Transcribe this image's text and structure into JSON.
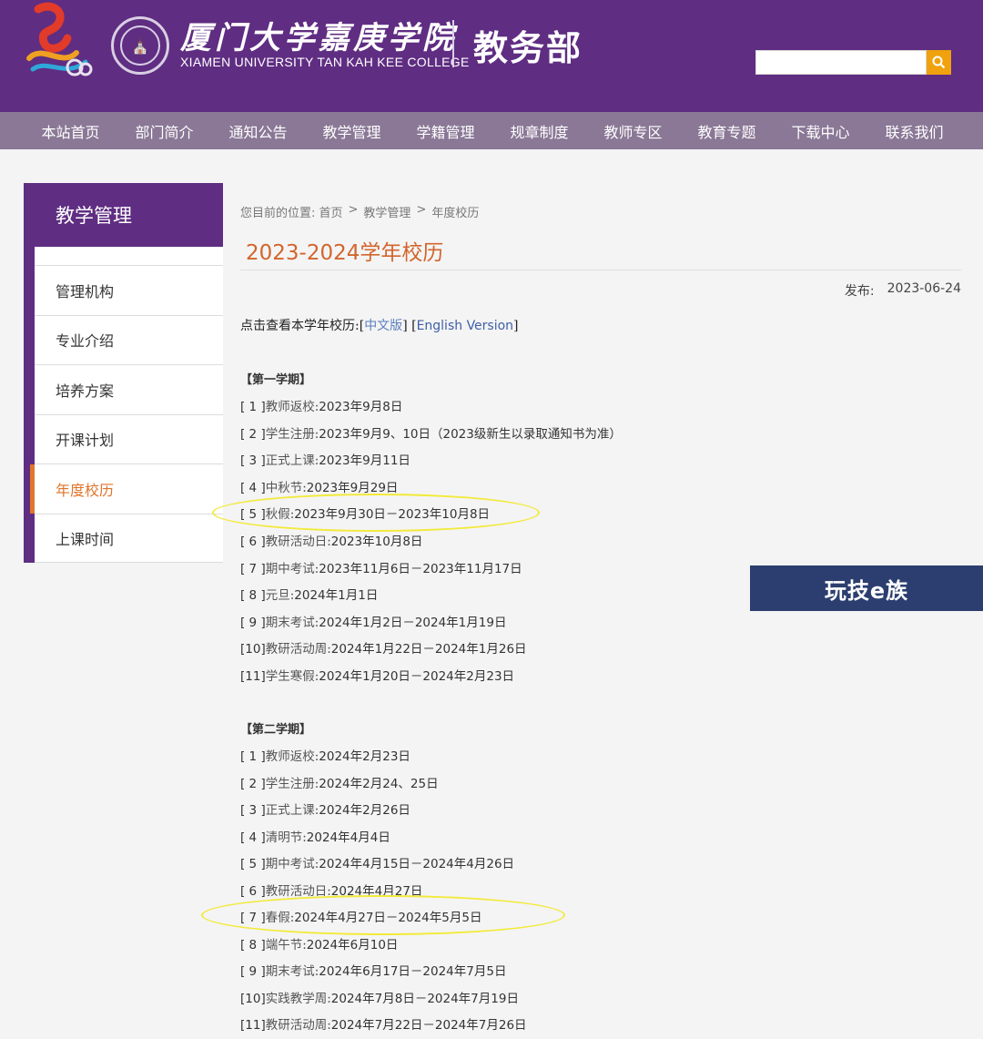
{
  "header": {
    "college_cn": "厦门大学嘉庚学院",
    "college_en": "XIAMEN UNIVERSITY TAN KAH KEE COLLEGE",
    "dept": "教务部",
    "search_placeholder": ""
  },
  "nav": [
    "本站首页",
    "部门简介",
    "通知公告",
    "教学管理",
    "学籍管理",
    "规章制度",
    "教师专区",
    "教育专题",
    "下载中心",
    "联系我们"
  ],
  "sidebar": {
    "title": "教学管理",
    "items": [
      "管理机构",
      "专业介绍",
      "培养方案",
      "开课计划",
      "年度校历",
      "上课时间"
    ],
    "active_index": 4
  },
  "breadcrumb": [
    "您目前的位置: 首页",
    ">",
    "教学管理",
    ">",
    "年度校历"
  ],
  "page_title": "2023-2024学年校历",
  "publish": {
    "label": "发布:",
    "date": "2023-06-24"
  },
  "view": {
    "prefix": "点击查看本学年校历:",
    "cn": "中文版",
    "en": "English Version"
  },
  "semester1": {
    "heading": "【第一学期】",
    "entries": [
      {
        "num": "[ 1 ]",
        "label": "教师返校:",
        "value": "2023年9月8日"
      },
      {
        "num": "[ 2 ]",
        "label": "学生注册:",
        "value": "2023年9月9、10日（2023级新生以录取通知书为准）"
      },
      {
        "num": "[ 3 ]",
        "label": "正式上课:",
        "value": "2023年9月11日"
      },
      {
        "num": "[ 4 ]",
        "label": "中秋节:",
        "value": "2023年9月29日"
      },
      {
        "num": "[ 5 ]",
        "label": "秋假:",
        "value": "2023年9月30日－2023年10月8日"
      },
      {
        "num": "[ 6 ]",
        "label": "教研活动日:",
        "value": "2023年10月8日"
      },
      {
        "num": "[ 7 ]",
        "label": "期中考试:",
        "value": "2023年11月6日－2023年11月17日"
      },
      {
        "num": "[ 8 ]",
        "label": "元旦:",
        "value": "2024年1月1日"
      },
      {
        "num": "[ 9 ]",
        "label": "期末考试:",
        "value": "2024年1月2日－2024年1月19日"
      },
      {
        "num": "[10]",
        "label": "教研活动周:",
        "value": "2024年1月22日－2024年1月26日"
      },
      {
        "num": "[11]",
        "label": "学生寒假:",
        "value": "2024年1月20日－2024年2月23日"
      }
    ]
  },
  "semester2": {
    "heading": "【第二学期】",
    "entries": [
      {
        "num": "[ 1 ]",
        "label": "教师返校:",
        "value": "2024年2月23日"
      },
      {
        "num": "[ 2 ]",
        "label": "学生注册:",
        "value": "2024年2月24、25日"
      },
      {
        "num": "[ 3 ]",
        "label": "正式上课:",
        "value": "2024年2月26日"
      },
      {
        "num": "[ 4 ]",
        "label": "清明节:",
        "value": "2024年4月4日"
      },
      {
        "num": "[ 5 ]",
        "label": "期中考试:",
        "value": "2024年4月15日－2024年4月26日"
      },
      {
        "num": "[ 6 ]",
        "label": "教研活动日:",
        "value": "2024年4月27日"
      },
      {
        "num": "[ 7 ]",
        "label": "春假:",
        "value": "2024年4月27日－2024年5月5日"
      },
      {
        "num": "[ 8 ]",
        "label": "端午节:",
        "value": "2024年6月10日"
      },
      {
        "num": "[ 9 ]",
        "label": "期末考试:",
        "value": "2024年6月17日－2024年7月5日"
      },
      {
        "num": "[10]",
        "label": "实践教学周:",
        "value": "2024年7月8日－2024年7月19日"
      },
      {
        "num": "[11]",
        "label": "教研活动周:",
        "value": "2024年7月22日－2024年7月26日"
      }
    ]
  },
  "watermark": "玩技e族",
  "colors": {
    "brand": "#5f2d82",
    "nav": "#8a7896",
    "accent": "#e0752b",
    "highlight": "#f2ea3a"
  }
}
